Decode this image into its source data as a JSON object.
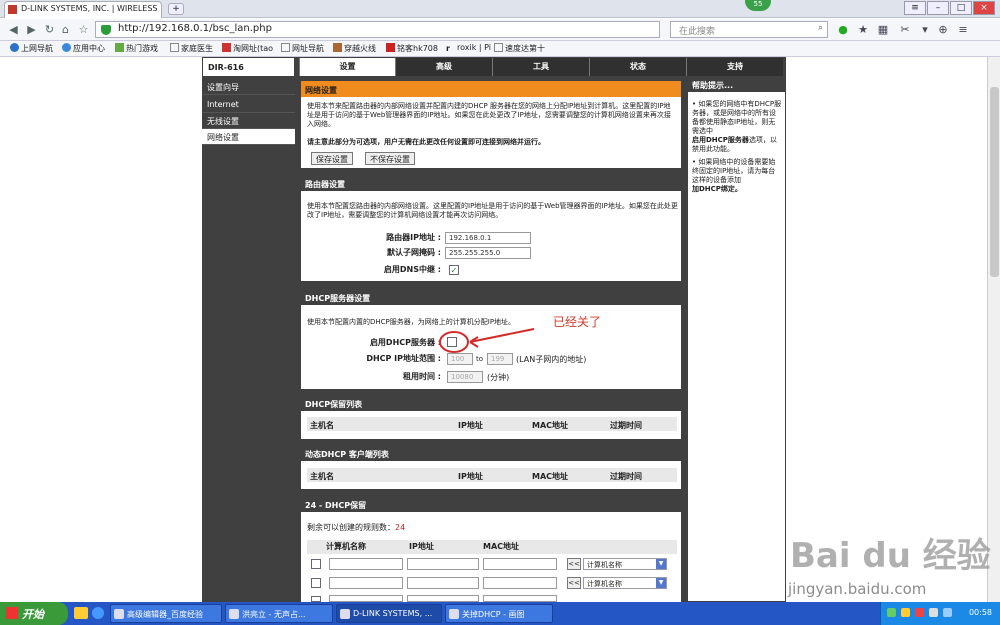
{
  "browser": {
    "tab_title": "D-LINK SYSTEMS, INC. | WIRELESS",
    "new_tab": "+",
    "url": "http://192.168.0.1/bsc_lan.php",
    "search_placeholder": "在此搜索",
    "badge": "55"
  },
  "bookmarks": [
    "上网导航",
    "应用中心",
    "热门游戏",
    "家庭医生",
    "淘网址(tao",
    "网址导航",
    "穿越火线",
    "铭客hk708",
    "roxik | Pi",
    "速度达第十"
  ],
  "leftnav": {
    "logo": "DIR-616",
    "items": [
      "设置向导",
      "Internet",
      "无线设置",
      "网络设置"
    ]
  },
  "topnav": [
    "设置",
    "高级",
    "工具",
    "状态",
    "支持"
  ],
  "net": {
    "title": "网络设置",
    "desc": "使用本节来配置路由器的内部网络设置并配置内建的DHCP 服务器在您的网络上分配IP地址到计算机。这里配置的IP地址是用于访问的基于Web管理器界面的IP地址。如果您在此处更改了IP地址，您需要调整您的计算机网络设置来再次接入网络。",
    "note": "请主意此部分为可选项，用户无需在此更改任何设置即可连接到网络并运行。",
    "save": "保存设置",
    "nosave": "不保存设置"
  },
  "router": {
    "title": "路由器设置",
    "desc": "使用本节配置您路由器的内部网络设置。这里配置的IP地址是用于访问的基于Web管理器界面的IP地址。如果您在此处更改了IP地址，需要调整您的计算机网络设置才能再次访问网络。",
    "ip_label": "路由器IP地址 :",
    "ip": "192.168.0.1",
    "mask_label": "默认子网掩码 :",
    "mask": "255.255.255.0",
    "dns_label": "启用DNS中继 :",
    "dns_check": "✓"
  },
  "dhcp": {
    "title": "DHCP服务器设置",
    "desc": "使用本节配置内置的DHCP服务器，为网络上的计算机分配IP地址。",
    "annotation": "已经关了",
    "enable_label": "启用DHCP服务器 :",
    "range_label": "DHCP IP地址范围 :",
    "range_start": "100",
    "to": "to",
    "range_end": "199",
    "range_note": "(LAN子网内的地址)",
    "lease_label": "租用时间 :",
    "lease": "10080",
    "lease_unit": "(分钟)"
  },
  "reserve_list": {
    "title": "DHCP保留列表",
    "cols": [
      "主机名",
      "IP地址",
      "MAC地址",
      "过期时间"
    ]
  },
  "dyn_list": {
    "title": "动态DHCP 客户端列表",
    "cols": [
      "主机名",
      "IP地址",
      "MAC地址",
      "过期时间"
    ]
  },
  "reserve24": {
    "title": "24 - DHCP保留",
    "remaining_label": "剩余可以创建的规则数：",
    "remaining": "24",
    "cols": [
      "计算机名称",
      "IP地址",
      "MAC地址"
    ],
    "btn": "<<",
    "select": "计算机名称"
  },
  "help": {
    "title": "帮助提示...",
    "p1": "• 如果您的网络中有DHCP服务器，或是网络中的所有设备都使用静态IP地址，则无需选中",
    "p1b": "启用DHCP服务器",
    "p1c": "选项，以禁用此功能。",
    "p2": "• 如果网络中的设备需要始终固定的IP地址，请为每台这样的设备添加",
    "p2b": "加DHCP绑定。"
  },
  "taskbar": {
    "start": "开始",
    "tasks": [
      "高级编辑器_百度经验",
      "洪亮立 - 无声占...",
      "D-LINK SYSTEMS, ...",
      "关掉DHCP - 画图"
    ],
    "clock": "00:58"
  },
  "watermark": {
    "main": "Bai du 经验",
    "sub": "jingyan.baidu.com"
  }
}
